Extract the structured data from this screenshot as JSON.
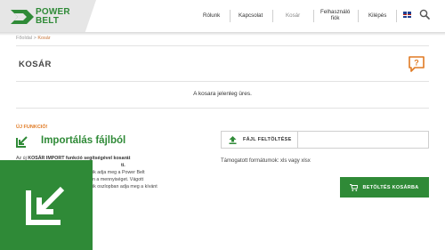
{
  "header": {
    "logo": {
      "line1": "POWER",
      "line2": "BELT"
    },
    "nav": [
      {
        "label": "Rólunk"
      },
      {
        "label": "Kapcsolat"
      },
      {
        "label": "Kosár",
        "active": true
      },
      {
        "label_line1": "Felhasználó",
        "label_line2": "fiók"
      },
      {
        "label": "Kilépés"
      }
    ],
    "language_icon": "uk-flag-icon",
    "search_icon": "search-icon"
  },
  "breadcrumb": {
    "home": "Főoldal",
    "separator": ">",
    "current": "Kosár"
  },
  "page": {
    "title": "KOSÁR",
    "empty_message": "A kosara jelenleg üres.",
    "help_icon": "speech-question-icon"
  },
  "import": {
    "new_label": "ÚJ FUNKCIÓ!",
    "title": "Importálás fájlból",
    "desc_line1_pre": "Az új ",
    "desc_line1_bold": "KOSÁR IMPORT funkció segítségével kosarát",
    "desc_line2_bold": "ti.",
    "desc_line3": "ik adja meg a Power Belt",
    "desc_line4": "n a mennyiséget. Vágott",
    "desc_line5": "ik oszlopban adja meg a kívánt",
    "file_button": "FÁJL FELTÖLTÉSE",
    "formats": "Támogatott formátumok: xls vagy xlsx",
    "load_button": "BETÖLTÉS KOSÁRBA"
  },
  "colors": {
    "brand_green": "#2f8a37",
    "accent_orange": "#e07a23"
  }
}
